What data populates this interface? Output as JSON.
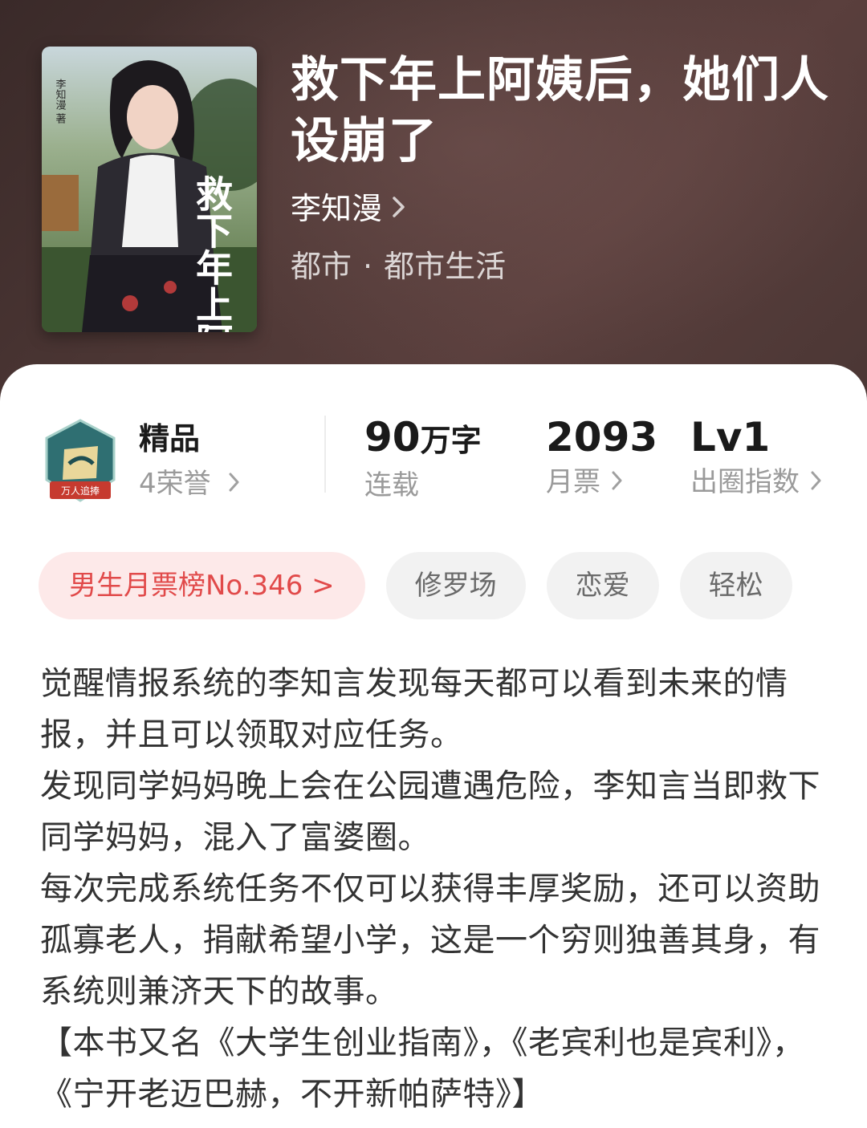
{
  "book": {
    "title": "救下年上阿姨后，她们人设崩了",
    "author": "李知漫",
    "category": "都市",
    "subcategory": "都市生活",
    "separator": "·",
    "cover_title_text": "救下年上阿姨后，她们人设崩了",
    "cover_author_text": "李知漫 著"
  },
  "stats": {
    "badge_label": "万人追捧",
    "jingpin": "精品",
    "honors": "4荣誉",
    "words_value": "90",
    "words_unit": "万字",
    "status": "连载",
    "monthly_votes_value": "2093",
    "monthly_votes_label": "月票",
    "circle_value": "Lv1",
    "circle_label": "出圈指数"
  },
  "tags": {
    "rank": "男生月票榜No.346 >",
    "items": [
      "修罗场",
      "恋爱",
      "轻松"
    ]
  },
  "description": [
    "觉醒情报系统的李知言发现每天都可以看到未来的情报，并且可以领取对应任务。",
    "发现同学妈妈晚上会在公园遭遇危险，李知言当即救下同学妈妈，混入了富婆圈。",
    "每次完成系统任务不仅可以获得丰厚奖励，还可以资助孤寡老人，捐献希望小学，这是一个穷则独善其身，有系统则兼济天下的故事。",
    "【本书又名《大学生创业指南》，《老宾利也是宾利》，《宁开老迈巴赫，不开新帕萨特》】"
  ],
  "colors": {
    "header_bg": "#4a3533",
    "rank_tag_bg": "#fde9e9",
    "rank_tag_text": "#e14a4a",
    "tag_bg": "#f2f2f2",
    "badge_teal": "#2f6f72",
    "badge_red": "#c63a2f"
  },
  "icons": {
    "author_chevron": "chevron-right-icon",
    "honor_chevron": "chevron-right-icon",
    "badge": "shield-badge-icon"
  }
}
